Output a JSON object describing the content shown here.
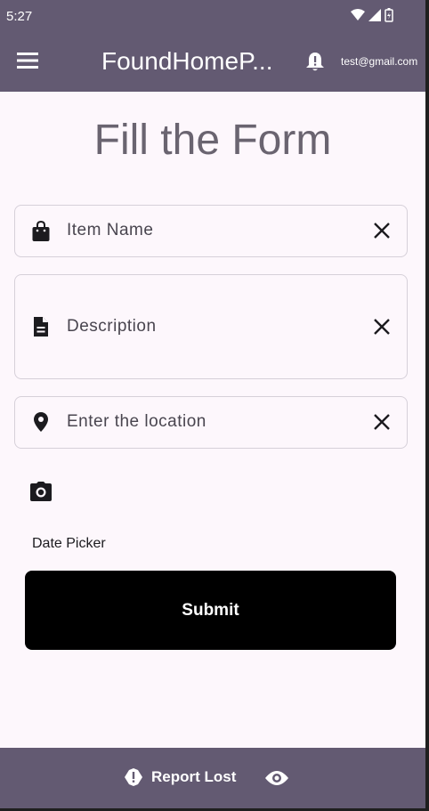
{
  "status_bar": {
    "time": "5:27"
  },
  "app_bar": {
    "title": "FoundHomeP...",
    "account_email": "test@gmail.com",
    "menu_icon": "menu-icon",
    "notification_icon": "bell-icon"
  },
  "form": {
    "heading": "Fill the Form",
    "item_name": {
      "placeholder": "Item Name",
      "icon": "shopping-bag-icon"
    },
    "description": {
      "placeholder": "Description",
      "icon": "document-icon"
    },
    "location": {
      "placeholder": "Enter the location",
      "icon": "location-pin-icon"
    },
    "camera_icon": "camera-icon",
    "date_picker_label": "Date Picker",
    "submit_label": "Submit"
  },
  "bottom_bar": {
    "report_label": "Report Lost",
    "report_icon": "alert-icon",
    "view_icon": "eye-icon"
  },
  "colors": {
    "app_bar": "#635a72",
    "background": "#fdf7fc",
    "submit_button": "#000000",
    "heading_text": "#6a6470"
  }
}
